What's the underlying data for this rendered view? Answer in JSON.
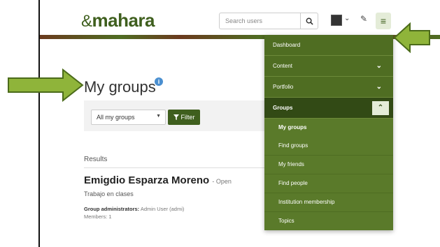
{
  "app": {
    "logo_text": "mahara",
    "logo_swirl": "&"
  },
  "header": {
    "search_placeholder": "Search users",
    "menu_icon": "hamburger-icon",
    "wrench_icon": "wrench-icon"
  },
  "page": {
    "title": "My groups"
  },
  "filter": {
    "select_value": "All my groups",
    "filter_label": "Filter"
  },
  "results": {
    "label": "Results"
  },
  "group": {
    "name": "Emigdio Esparza Moreno",
    "status": "- Open",
    "description": "Trabajo en clases",
    "admins_label": "Group administrators:",
    "admins_value": "Admin User (admi)",
    "members": "Members: 1"
  },
  "menu": {
    "items": [
      {
        "label": "Dashboard"
      },
      {
        "label": "Content"
      },
      {
        "label": "Portfolio"
      },
      {
        "label": "Groups"
      }
    ],
    "groups_sub": [
      {
        "label": "My groups"
      },
      {
        "label": "Find groups"
      },
      {
        "label": "My friends"
      },
      {
        "label": "Find people"
      },
      {
        "label": "Institution membership"
      },
      {
        "label": "Topics"
      }
    ]
  },
  "colors": {
    "brand_green": "#3f5f1e",
    "menu_green": "#4f6d22",
    "arrow_green": "#8fb43a"
  }
}
